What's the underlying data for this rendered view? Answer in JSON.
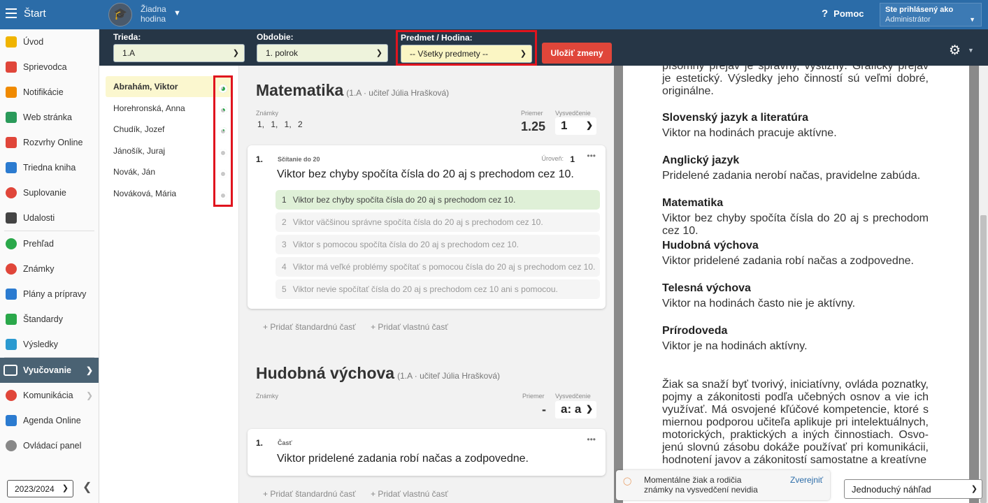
{
  "topbar": {
    "app_title": "Štart",
    "lesson_name": "Žiadna hodina",
    "help_label": "Pomoc",
    "user_line1": "Ste prihlásený ako",
    "user_line2": "Administrátor"
  },
  "filters": {
    "class_label": "Trieda:",
    "class_value": "1.A",
    "period_label": "Obdobie:",
    "period_value": "1. polrok",
    "subject_label": "Predmet / Hodina:",
    "subject_value": "-- Všetky predmety --",
    "save_label": "Uložiť zmeny"
  },
  "sidebar": {
    "items": [
      {
        "label": "Úvod",
        "icon": "star-icon",
        "color": "#f0b400"
      },
      {
        "label": "Sprievodca",
        "icon": "wand-icon",
        "color": "#e0463a"
      },
      {
        "label": "Notifikácie",
        "icon": "mail-icon",
        "color": "#f08a00"
      },
      {
        "label": "Web stránka",
        "icon": "house-icon",
        "color": "#2a9a5a"
      },
      {
        "label": "Rozvrhy Online",
        "icon": "calendar-grid-icon",
        "color": "#e0463a"
      },
      {
        "label": "Triedna kniha",
        "icon": "book-icon",
        "color": "#2b7bd0"
      },
      {
        "label": "Suplovanie",
        "icon": "person-icon",
        "color": "#e0463a"
      },
      {
        "label": "Udalosti",
        "icon": "calendar-icon",
        "color": "#444444"
      },
      {
        "label": "Prehľad",
        "icon": "check-circle-icon",
        "color": "#2aa84a"
      },
      {
        "label": "Známky",
        "icon": "chart-circle-icon",
        "color": "#e0463a"
      },
      {
        "label": "Plány a prípravy",
        "icon": "briefcase-icon",
        "color": "#2b7bd0"
      },
      {
        "label": "Štandardy",
        "icon": "shield-check-icon",
        "color": "#2aa84a"
      },
      {
        "label": "Výsledky",
        "icon": "bar-chart-icon",
        "color": "#2b9ad0"
      },
      {
        "label": "Vyučovanie",
        "icon": "open-book-icon",
        "color": "#ffffff"
      },
      {
        "label": "Komunikácia",
        "icon": "chat-icon",
        "color": "#e0463a"
      },
      {
        "label": "Agenda Online",
        "icon": "pen-icon",
        "color": "#2b7bd0"
      },
      {
        "label": "Ovládací panel",
        "icon": "gear-icon",
        "color": "#888888"
      }
    ],
    "year_value": "2023/2024"
  },
  "students": [
    {
      "name": "Abrahám, Viktor",
      "progress": 0.65
    },
    {
      "name": "Horehronská, Anna",
      "progress": 0.3
    },
    {
      "name": "Chudík, Jozef",
      "progress": 0.15
    },
    {
      "name": "Jánošík, Juraj",
      "progress": 0
    },
    {
      "name": "Novák, Ján",
      "progress": 0
    },
    {
      "name": "Nováková, Mária",
      "progress": 0
    }
  ],
  "subjects": [
    {
      "title": "Matematika",
      "subtitle": "(1.A · učiteľ Júlia Hrašková)",
      "grades_label": "Známky",
      "grades": "1, 1, 1, 2",
      "avg_label": "Priemer",
      "avg_value": "1.25",
      "report_label": "Vysvedčenie",
      "report_value": "1",
      "card": {
        "num": "1.",
        "title": "Sčítanie do 20",
        "level_label": "Úroveň:",
        "level_value": "1",
        "desc": "Viktor bez chyby spočíta čísla do 20 aj s prechodom cez 10.",
        "options": [
          {
            "num": "1",
            "text": "Viktor bez chyby spočíta čísla do 20 aj s prechodom cez 10."
          },
          {
            "num": "2",
            "text": "Viktor väčšinou správne spočíta čísla do 20 aj s prechodom cez 10."
          },
          {
            "num": "3",
            "text": "Viktor s pomocou spočíta čísla do 20 aj s prechodom cez 10."
          },
          {
            "num": "4",
            "text": "Viktor má veľké problémy spočítať s pomocou čísla do 20 aj s prechodom cez 10."
          },
          {
            "num": "5",
            "text": "Viktor nevie spočítať čísla do 20 aj s prechodom cez 10 ani s pomocou."
          }
        ]
      }
    },
    {
      "title": "Hudobná výchova",
      "subtitle": "(1.A · učiteľ Júlia Hrašková)",
      "grades_label": "Známky",
      "avg_label": "Priemer",
      "avg_value": "-",
      "report_label": "Vysvedčenie",
      "report_value": "a: a",
      "card": {
        "num": "1.",
        "title": "Časť",
        "desc": "Viktor pridelené zadania robí načas a zodpovedne."
      }
    }
  ],
  "add_actions": {
    "standard": "+ Pridať štandardnú časť",
    "own": "+ Pridať vlastnú časť"
  },
  "preview": {
    "top_text": "písomný prejav je správny, výstižný. Grafický prejav je estetický. Výsledky jeho činností sú veľmi dobré, originálne.",
    "sections": [
      {
        "head": "Slovenský jazyk a literatúra",
        "text": "Viktor na hodinách pracuje aktívne."
      },
      {
        "head": "Anglický jazyk",
        "text": "Pridelené zadania nerobí načas, pravidelne zabúda."
      },
      {
        "head": "Matematika",
        "text": "Viktor bez chyby spočíta čísla do 20 aj s prechodom cez 10."
      },
      {
        "head": "Hudobná výchova",
        "text": "Viktor pridelené zadania robí načas a zodpovedne."
      },
      {
        "head": "Telesná výchova",
        "text": "Viktor na hodinách často nie je aktívny."
      },
      {
        "head": "Prírodoveda",
        "text": "Viktor je na hodinách aktívny."
      }
    ],
    "summary": "Žiak sa snaží byť tvorivý, iniciatívny, ovláda poznatky, pojmy a zákonitosti podľa učebných osnov a vie ich využívať. Má osvojené kľúčové kompetencie, ktoré s miernou podporou učiteľa aplikuje pri intelektuálnych, motorických, praktických a iných činnostiach. Osvo- jenú slovnú zásobu dokáže používať pri komunikácii, hodnotení javov a zákonitostí samostatne a kreatívne",
    "notice_text": "Momentálne žiak a rodičia známky na vysvedčení nevidia",
    "notice_link": "Zverejniť",
    "view_value": "Jednoduchý náhľad"
  }
}
